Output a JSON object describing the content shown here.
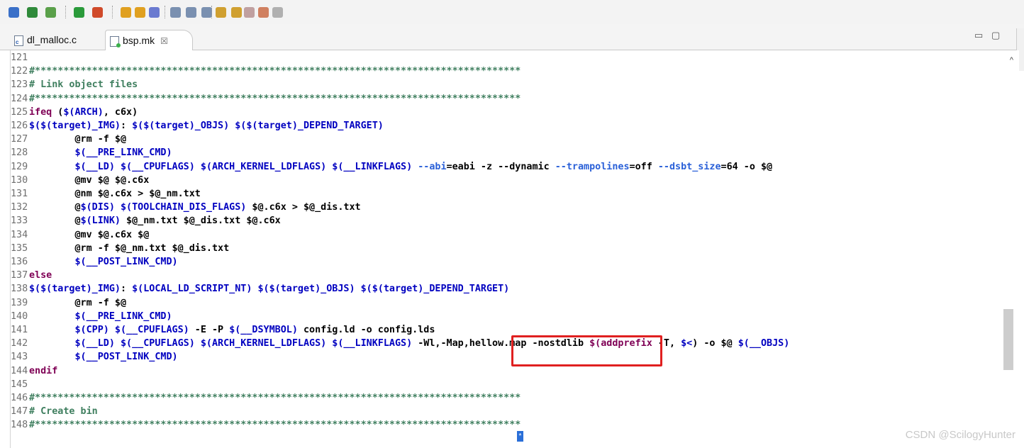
{
  "toolbar": {
    "items": [
      {
        "icon": "new-file-icon",
        "color": "#3a70c8"
      },
      {
        "icon": "run-config-icon",
        "color": "#2f8a3a"
      },
      {
        "icon": "debug-icon",
        "color": "#5aa04a"
      },
      {
        "icon": "run-icon",
        "color": "#2a9a3a"
      },
      {
        "icon": "external-tools-icon",
        "color": "#d04a2a"
      },
      {
        "icon": "open-folder-icon",
        "color": "#e0a020"
      },
      {
        "icon": "open-folder-alt-icon",
        "color": "#e0a020"
      },
      {
        "icon": "pen-icon",
        "color": "#6a7ad0"
      },
      {
        "icon": "toggle-mark-icon",
        "color": "#7a90b0"
      },
      {
        "icon": "toggle-block-icon",
        "color": "#7a90b0"
      },
      {
        "icon": "show-whitespace-icon",
        "color": "#7a90b0"
      },
      {
        "icon": "next-annotation-icon",
        "color": "#d0a030"
      },
      {
        "icon": "prev-annotation-icon",
        "color": "#d0a030"
      },
      {
        "icon": "last-edit-icon",
        "color": "#c0a0a0"
      },
      {
        "icon": "back-icon",
        "color": "#d08060"
      },
      {
        "icon": "forward-icon",
        "color": "#b0b0b0"
      }
    ]
  },
  "tabs": [
    {
      "label": "dl_malloc.c",
      "badge": "c"
    },
    {
      "label": "bsp.mk",
      "close": "☒"
    }
  ],
  "window_buttons": {
    "minimize": "▭",
    "maximize": "▢"
  },
  "editor": {
    "lines": [
      {
        "n": "121",
        "segs": []
      },
      {
        "n": "122",
        "segs": [
          {
            "t": "#*************************************************************************************",
            "c": "c"
          }
        ]
      },
      {
        "n": "123",
        "segs": [
          {
            "t": "# Link object files",
            "c": "c"
          }
        ]
      },
      {
        "n": "124",
        "segs": [
          {
            "t": "#*************************************************************************************",
            "c": "c"
          }
        ]
      },
      {
        "n": "125",
        "segs": [
          {
            "t": "ifeq",
            "c": "kw"
          },
          {
            "t": " (",
            "c": ""
          },
          {
            "t": "$(ARCH)",
            "c": "v"
          },
          {
            "t": ", c6x)",
            "c": ""
          }
        ]
      },
      {
        "n": "126",
        "segs": [
          {
            "t": "$($(target)_IMG)",
            "c": "v"
          },
          {
            "t": ": ",
            "c": ""
          },
          {
            "t": "$($(target)_OBJS) $($(target)_DEPEND_TARGET)",
            "c": "v"
          }
        ]
      },
      {
        "n": "127",
        "segs": [
          {
            "t": "        @rm -f $@",
            "c": ""
          }
        ]
      },
      {
        "n": "128",
        "segs": [
          {
            "t": "        ",
            "c": ""
          },
          {
            "t": "$(__PRE_LINK_CMD)",
            "c": "v"
          }
        ]
      },
      {
        "n": "129",
        "segs": [
          {
            "t": "        ",
            "c": ""
          },
          {
            "t": "$(__LD) $(__CPUFLAGS) $(ARCH_KERNEL_LDFLAGS) $(__LINKFLAGS)",
            "c": "v"
          },
          {
            "t": " ",
            "c": ""
          },
          {
            "t": "--abi",
            "c": "opt"
          },
          {
            "t": "=eabi -z --dynamic ",
            "c": ""
          },
          {
            "t": "--trampolines",
            "c": "opt"
          },
          {
            "t": "=off ",
            "c": ""
          },
          {
            "t": "--dsbt_size",
            "c": "opt"
          },
          {
            "t": "=64 -o $@",
            "c": ""
          }
        ]
      },
      {
        "n": "130",
        "segs": [
          {
            "t": "        @mv $@ $@.c6x",
            "c": ""
          }
        ]
      },
      {
        "n": "131",
        "segs": [
          {
            "t": "        @nm $@.c6x > $@_nm.txt",
            "c": ""
          }
        ]
      },
      {
        "n": "132",
        "segs": [
          {
            "t": "        @",
            "c": ""
          },
          {
            "t": "$(DIS) $(TOOLCHAIN_DIS_FLAGS)",
            "c": "v"
          },
          {
            "t": " $@.c6x > $@_dis.txt",
            "c": ""
          }
        ]
      },
      {
        "n": "133",
        "segs": [
          {
            "t": "        @",
            "c": ""
          },
          {
            "t": "$(LINK)",
            "c": "v"
          },
          {
            "t": " $@_nm.txt $@_dis.txt $@.c6x",
            "c": ""
          }
        ]
      },
      {
        "n": "134",
        "segs": [
          {
            "t": "        @mv $@.c6x $@",
            "c": ""
          }
        ]
      },
      {
        "n": "135",
        "segs": [
          {
            "t": "        @rm -f $@_nm.txt $@_dis.txt",
            "c": ""
          }
        ]
      },
      {
        "n": "136",
        "segs": [
          {
            "t": "        ",
            "c": ""
          },
          {
            "t": "$(__POST_LINK_CMD)",
            "c": "v"
          }
        ]
      },
      {
        "n": "137",
        "segs": [
          {
            "t": "else",
            "c": "kw"
          }
        ]
      },
      {
        "n": "138",
        "segs": [
          {
            "t": "$($(target)_IMG)",
            "c": "v"
          },
          {
            "t": ": ",
            "c": ""
          },
          {
            "t": "$(LOCAL_LD_SCRIPT_NT) $($(target)_OBJS) $($(target)_DEPEND_TARGET)",
            "c": "v"
          }
        ]
      },
      {
        "n": "139",
        "segs": [
          {
            "t": "        @rm -f $@",
            "c": ""
          }
        ]
      },
      {
        "n": "140",
        "segs": [
          {
            "t": "        ",
            "c": ""
          },
          {
            "t": "$(__PRE_LINK_CMD)",
            "c": "v"
          }
        ]
      },
      {
        "n": "141",
        "segs": [
          {
            "t": "        ",
            "c": ""
          },
          {
            "t": "$(CPP) $(__CPUFLAGS)",
            "c": "v"
          },
          {
            "t": " -E -P ",
            "c": ""
          },
          {
            "t": "$(__DSYMBOL)",
            "c": "v"
          },
          {
            "t": " config.ld -o config.lds",
            "c": ""
          }
        ]
      },
      {
        "n": "142",
        "segs": [
          {
            "t": "        ",
            "c": ""
          },
          {
            "t": "$(__LD) $(__CPUFLAGS) $(ARCH_KERNEL_LDFLAGS) $(__LINKFLAGS)",
            "c": "v"
          },
          {
            "t": " -Wl,-Map,hellow.map -nostdlib ",
            "c": ""
          },
          {
            "t": "$(addprefix",
            "c": "fn"
          },
          {
            "t": " -T, ",
            "c": ""
          },
          {
            "t": "$<",
            "c": "v"
          },
          {
            "t": ") -o $@ ",
            "c": ""
          },
          {
            "t": "$(__OBJS)",
            "c": "v"
          }
        ]
      },
      {
        "n": "143",
        "segs": [
          {
            "t": "        ",
            "c": ""
          },
          {
            "t": "$(__POST_LINK_CMD)",
            "c": "v"
          }
        ]
      },
      {
        "n": "144",
        "segs": [
          {
            "t": "endif",
            "c": "kw"
          }
        ]
      },
      {
        "n": "145",
        "segs": []
      },
      {
        "n": "146",
        "segs": [
          {
            "t": "#*************************************************************************************",
            "c": "c"
          }
        ]
      },
      {
        "n": "147",
        "segs": [
          {
            "t": "# Create bin",
            "c": "c"
          }
        ]
      },
      {
        "n": "148",
        "segs": [
          {
            "t": "#*************************************************************************************",
            "c": "c"
          }
        ]
      }
    ],
    "highlight_color": "#e02020",
    "cursor_glyph": "*"
  },
  "scrollbar": {
    "up_arrow": "^"
  },
  "watermark": "CSDN @ScilogyHunter"
}
